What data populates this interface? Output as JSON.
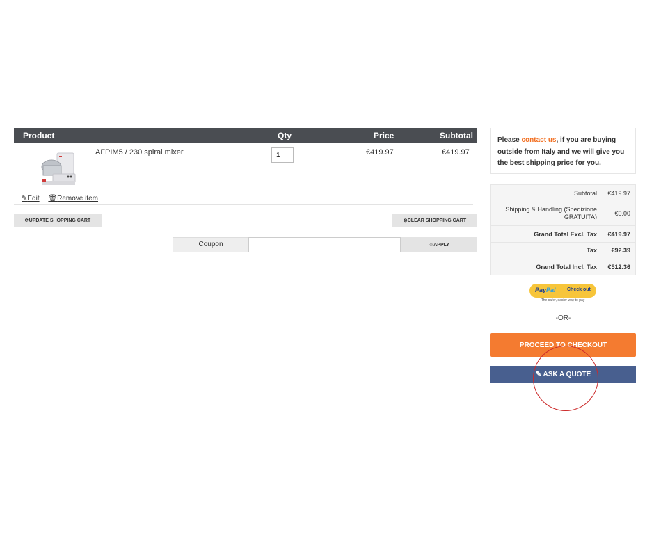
{
  "cart": {
    "headers": {
      "product": "Product",
      "qty": "Qty",
      "price": "Price",
      "subtotal": "Subtotal"
    },
    "item": {
      "name": "AFPIM5 / 230 spiral mixer",
      "qty": "1",
      "price": "€419.97",
      "subtotal": "€419.97",
      "edit_label": "Edit",
      "remove_label": "Remove item"
    },
    "update_label": "UPDATE SHOPPING CART",
    "clear_label": "CLEAR SHOPPING CART",
    "coupon_label": "Coupon",
    "coupon_value": "",
    "apply_label": "APPLY"
  },
  "sidebar": {
    "notice": {
      "before": "Please ",
      "link": "contact us",
      "after": ", if you are buying outside from Italy and we will give you the best shipping price for you."
    },
    "totals": [
      {
        "label": "Subtotal",
        "value": "€419.97",
        "bold": false
      },
      {
        "label": "Shipping & Handling (Spedizione GRATUITA)",
        "value": "€0.00",
        "bold": false
      },
      {
        "label": "Grand Total Excl. Tax",
        "value": "€419.97",
        "bold": true
      },
      {
        "label": "Tax",
        "value": "€92.39",
        "bold": true
      },
      {
        "label": "Grand Total Incl. Tax",
        "value": "€512.36",
        "bold": true
      }
    ],
    "paypal": {
      "pay": "Pay",
      "pal": "Pal",
      "checkout": "Check out",
      "tagline": "The safer, easier way to pay"
    },
    "or_label": "-OR-",
    "checkout_label": "PROCEED TO CHECKOUT",
    "quote_label": "ASK A QUOTE"
  },
  "colors": {
    "header_bg": "#4a4d52",
    "accent_orange": "#f47b30",
    "quote_blue": "#485f8f",
    "annotation_red": "#cc2a2a"
  }
}
